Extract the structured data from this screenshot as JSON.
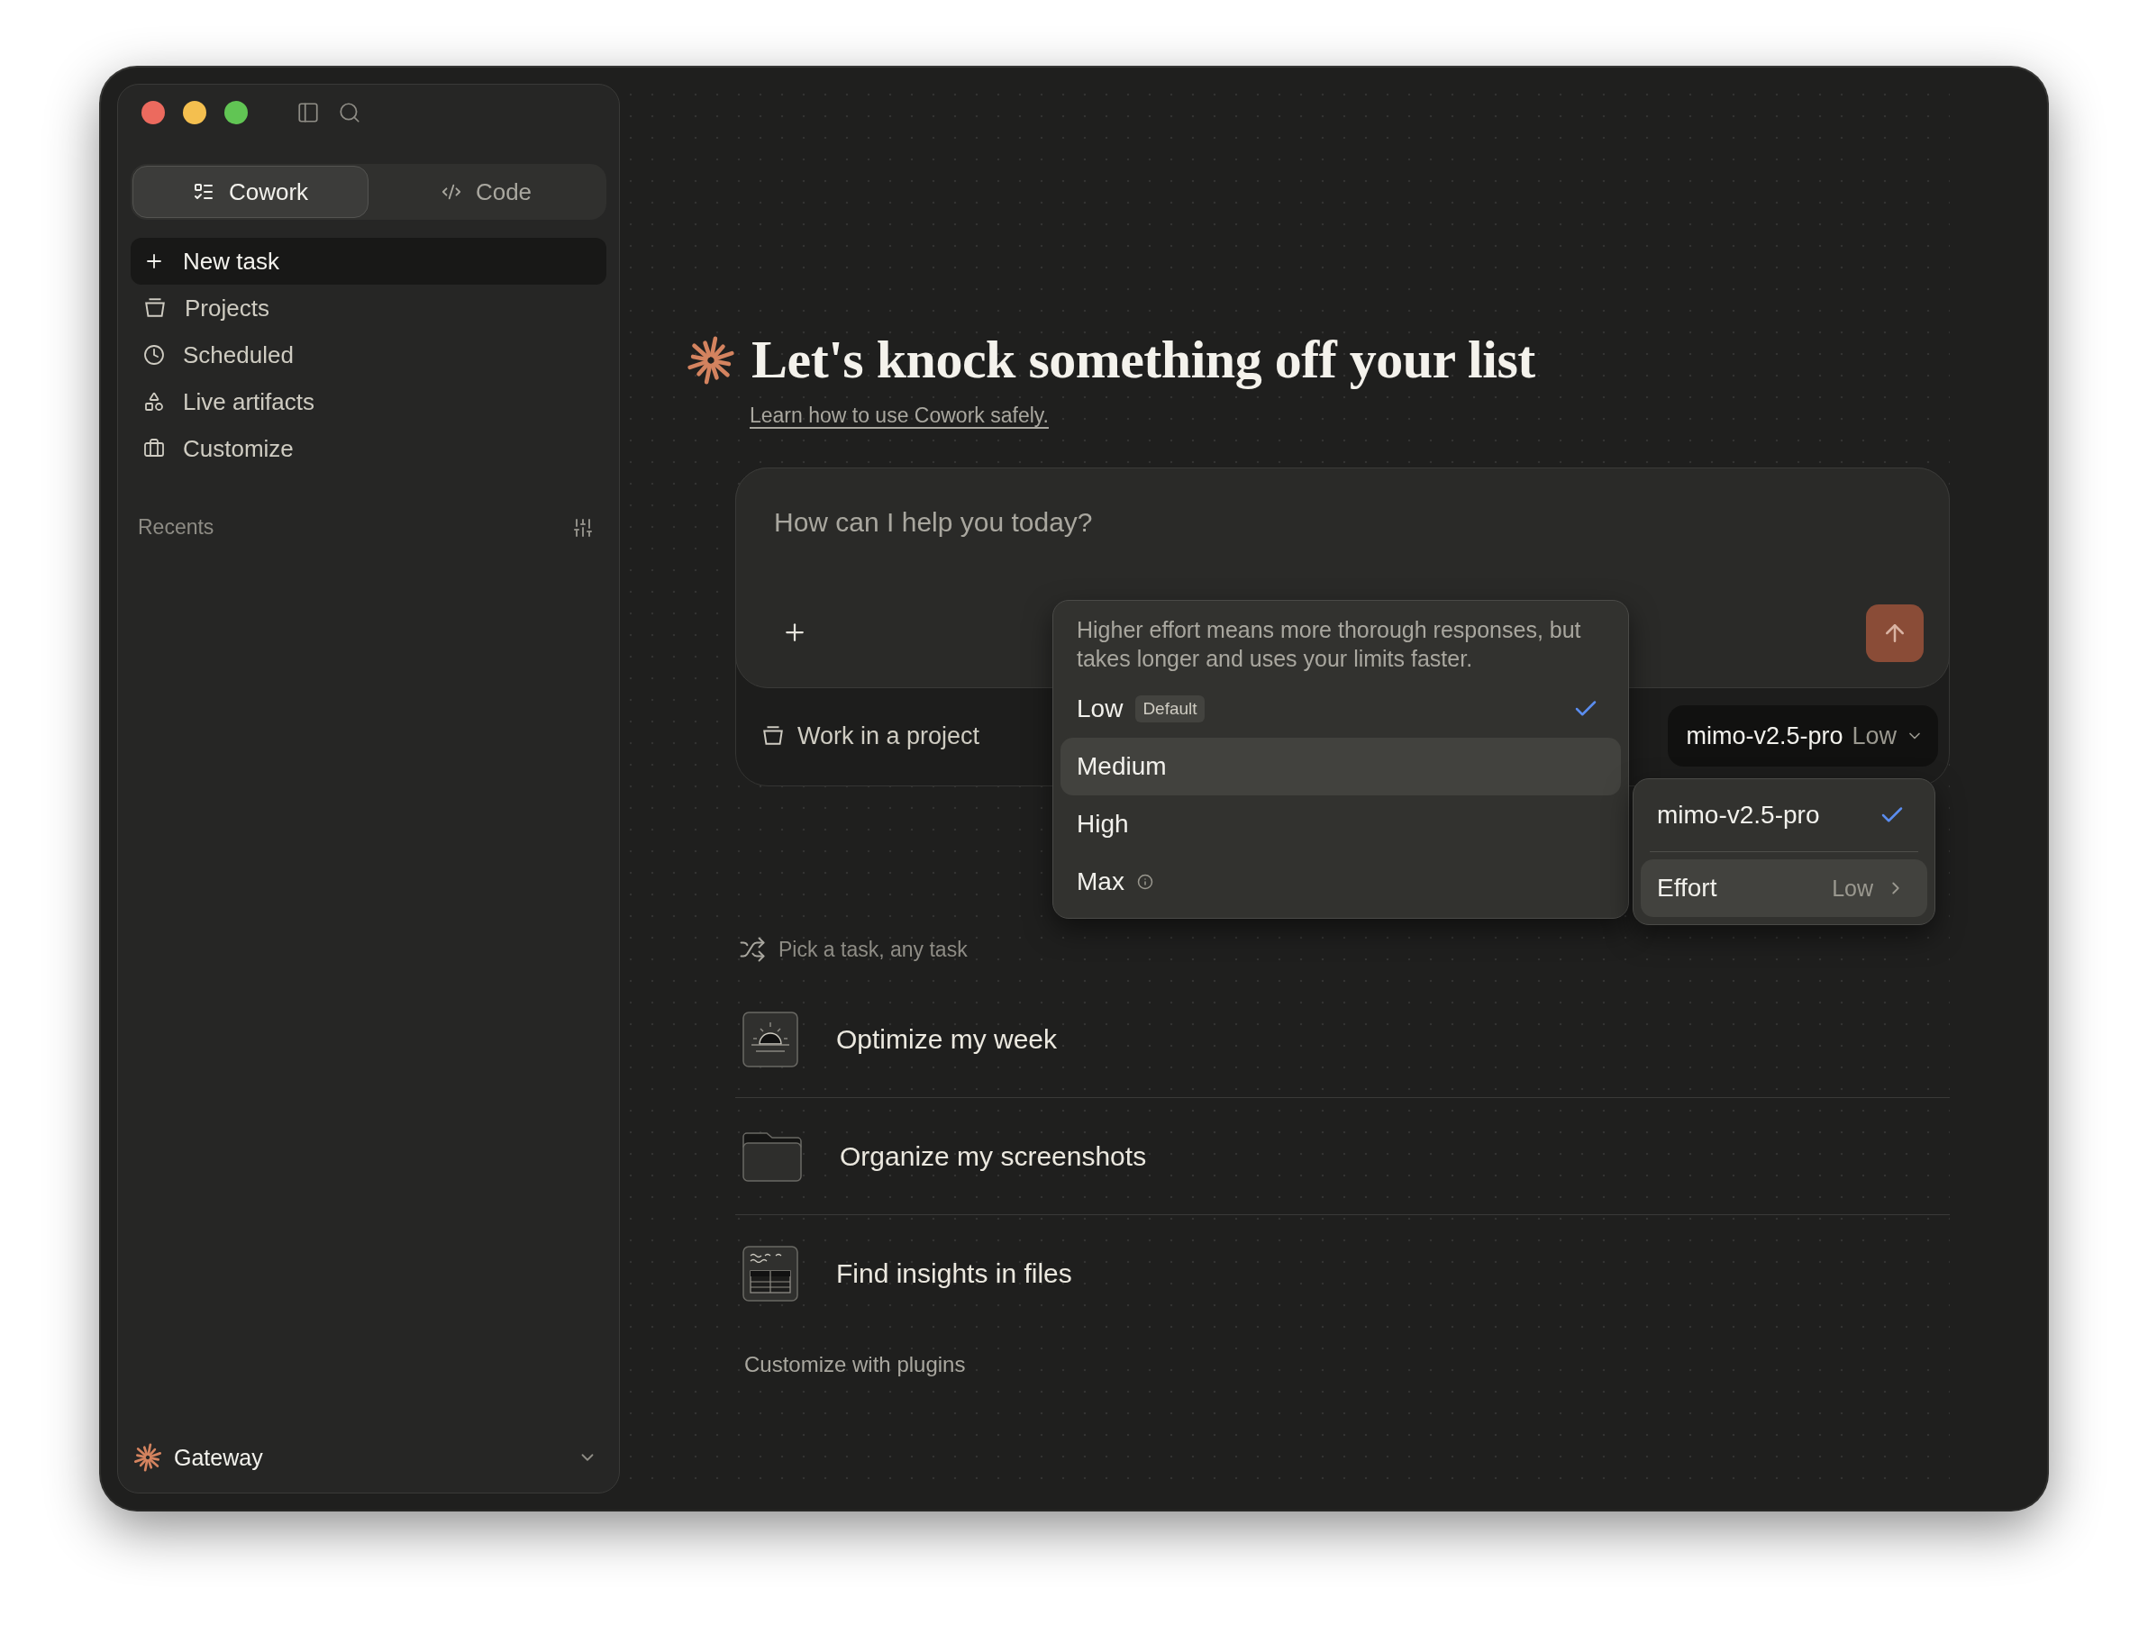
{
  "sidebar": {
    "modes": [
      {
        "label": "Cowork",
        "kind": "cowork",
        "selected": true
      },
      {
        "label": "Code",
        "kind": "code",
        "selected": false
      }
    ],
    "items": [
      {
        "label": "New task",
        "kind": "plus",
        "selected": true
      },
      {
        "label": "Projects",
        "kind": "projects",
        "selected": false
      },
      {
        "label": "Scheduled",
        "kind": "clock",
        "selected": false
      },
      {
        "label": "Live artifacts",
        "kind": "shapes",
        "selected": false
      },
      {
        "label": "Customize",
        "kind": "briefcase",
        "selected": false
      }
    ],
    "recents_label": "Recents",
    "account": {
      "name": "Gateway"
    }
  },
  "main": {
    "heading": "Let's knock something off your list",
    "link": "Learn how to use Cowork safely.",
    "composer": {
      "placeholder": "How can I help you today?",
      "project_button": "Work in a project",
      "model": "mimo-v2.5-pro",
      "effort": "Low"
    },
    "effort_menu": {
      "description": "Higher effort means more thorough responses, but takes longer and uses your limits faster.",
      "options": [
        {
          "label": "Low",
          "badge": "Default",
          "checked": true,
          "highlighted": false,
          "info": false
        },
        {
          "label": "Medium",
          "checked": false,
          "highlighted": true,
          "info": false
        },
        {
          "label": "High",
          "checked": false,
          "highlighted": false,
          "info": false
        },
        {
          "label": "Max",
          "checked": false,
          "highlighted": false,
          "info": true
        }
      ]
    },
    "model_menu": {
      "models": [
        {
          "label": "mimo-v2.5-pro",
          "checked": true
        }
      ],
      "effort": {
        "label": "Effort",
        "value": "Low",
        "highlighted": true
      }
    },
    "suggestions": {
      "heading": "Pick a task, any task",
      "tasks": [
        {
          "label": "Optimize my week",
          "kind": "sun"
        },
        {
          "label": "Organize my screenshots",
          "kind": "folder"
        },
        {
          "label": "Find insights in files",
          "kind": "table"
        }
      ],
      "footer": "Customize with plugins"
    }
  }
}
